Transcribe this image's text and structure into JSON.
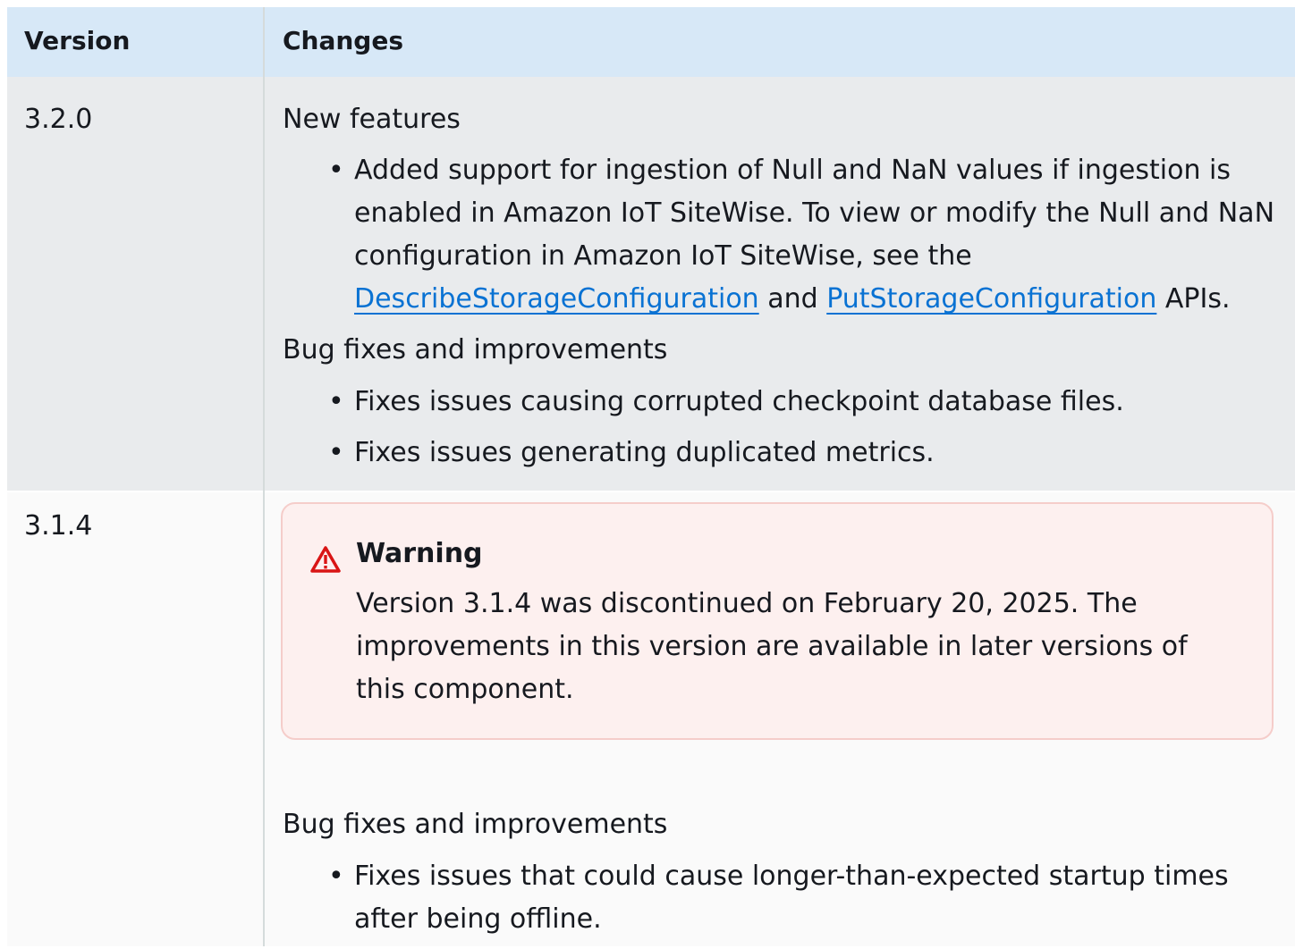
{
  "table": {
    "headers": {
      "version": "Version",
      "changes": "Changes"
    },
    "rows": [
      {
        "version": "3.2.0",
        "new_features_heading": "New features",
        "new_features_item": {
          "text_before": "Added support for ingestion of Null and NaN values if ingestion is enabled in Amazon IoT SiteWise. To view or modify the Null and NaN configuration in Amazon IoT SiteWise, see the ",
          "link1": "DescribeStorageConfiguration",
          "text_middle": " and ",
          "link2": "PutStorageConfiguration",
          "text_after": " APIs."
        },
        "bug_fixes_heading": "Bug fixes and improvements",
        "bug_fixes": [
          "Fixes issues causing corrupted checkpoint database files.",
          "Fixes issues generating duplicated metrics."
        ]
      },
      {
        "version": "3.1.4",
        "warning": {
          "title": "Warning",
          "body": "Version 3.1.4 was discontinued on February 20, 2025. The improvements in this version are available in later versions of this component."
        },
        "bug_fixes_heading": "Bug fixes and improvements",
        "bug_fixes": [
          "Fixes issues that could cause longer-than-expected startup times after being offline."
        ]
      }
    ]
  },
  "colors": {
    "header_bg": "#d7e8f7",
    "row_alt_bg": "#e9ebed",
    "row_bg": "#fafafa",
    "link": "#0972d3",
    "warning_bg": "#fdf0ef",
    "warning_border": "#f5cdca",
    "warning_icon": "#d91515"
  },
  "icons": {
    "warning": "warning-triangle-icon"
  }
}
